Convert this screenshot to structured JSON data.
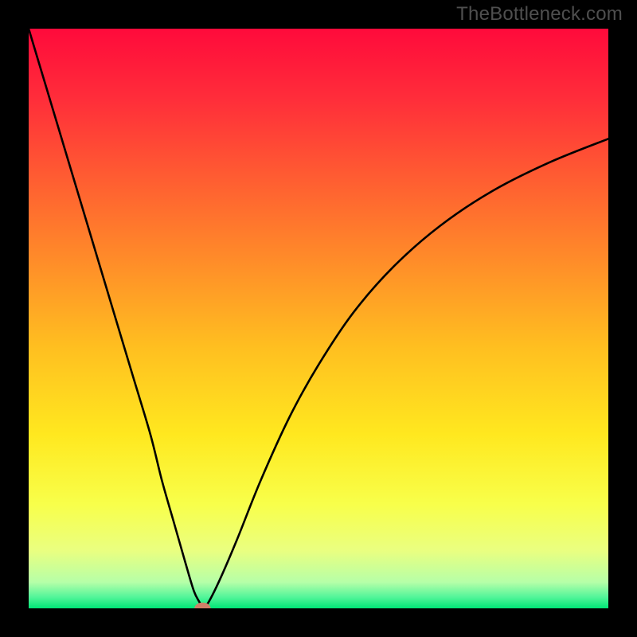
{
  "watermark": "TheBottleneck.com",
  "chart_data": {
    "type": "line",
    "title": "",
    "xlabel": "",
    "ylabel": "",
    "xlim": [
      0,
      100
    ],
    "ylim": [
      0,
      100
    ],
    "grid": false,
    "legend": false,
    "background_gradient": {
      "direction": "vertical",
      "stops": [
        {
          "pos": 0.0,
          "color": "#ff0a3b"
        },
        {
          "pos": 0.12,
          "color": "#ff2d3a"
        },
        {
          "pos": 0.25,
          "color": "#ff5a32"
        },
        {
          "pos": 0.4,
          "color": "#ff8c29"
        },
        {
          "pos": 0.55,
          "color": "#ffbf20"
        },
        {
          "pos": 0.7,
          "color": "#ffe81f"
        },
        {
          "pos": 0.82,
          "color": "#f8ff4a"
        },
        {
          "pos": 0.9,
          "color": "#eaff80"
        },
        {
          "pos": 0.955,
          "color": "#b6ffa8"
        },
        {
          "pos": 0.98,
          "color": "#55f59a"
        },
        {
          "pos": 1.0,
          "color": "#00e676"
        }
      ]
    },
    "series": [
      {
        "name": "bottleneck-curve",
        "color": "#000000",
        "x": [
          0,
          3,
          6,
          9,
          12,
          15,
          18,
          21,
          23,
          25,
          27,
          28.5,
          29.5,
          30,
          31,
          33,
          36,
          40,
          45,
          50,
          56,
          63,
          71,
          80,
          90,
          100
        ],
        "values": [
          100,
          90,
          80,
          70,
          60,
          50,
          40,
          30,
          22,
          15,
          8,
          3,
          1,
          0,
          1,
          5,
          12,
          22,
          33,
          42,
          51,
          59,
          66,
          72,
          77,
          81
        ]
      }
    ],
    "marker": {
      "name": "optimal-point",
      "x": 30,
      "y": 0,
      "color": "#d08068",
      "rx": 1.4,
      "ry": 1.0
    }
  }
}
